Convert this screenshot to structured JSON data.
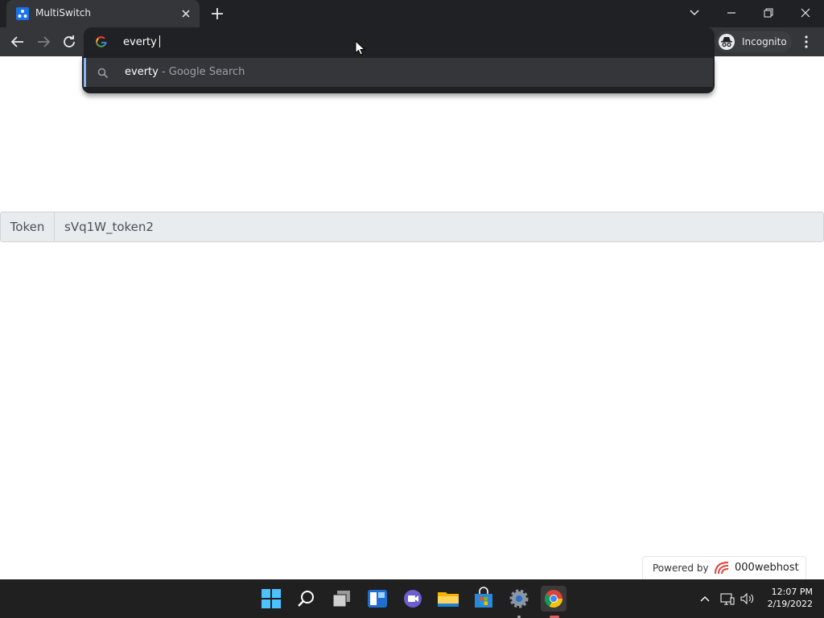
{
  "browser": {
    "tab": {
      "title": "MultiSwitch",
      "favicon": "multiswitch-favicon"
    },
    "address_bar": {
      "text": "everty"
    },
    "profile": {
      "label": "Incognito"
    },
    "colors": {
      "frame": "#202124",
      "toolbar": "#35363a",
      "accent": "#8ab4f8"
    }
  },
  "suggestions": [
    {
      "query": "everty",
      "suffix": " - Google Search",
      "icon": "search-icon"
    }
  ],
  "page": {
    "token": {
      "label": "Token",
      "value": "sVq1W_token2"
    },
    "footer": {
      "powered_label": "Powered by",
      "brand": "000webhost"
    }
  },
  "taskbar": {
    "apps": [
      "start",
      "search",
      "task-view",
      "widgets",
      "chat",
      "file-explorer",
      "store",
      "settings",
      "chrome"
    ],
    "active_app": "chrome",
    "clock": {
      "time": "12:07 PM",
      "date": "2/19/2022"
    }
  }
}
